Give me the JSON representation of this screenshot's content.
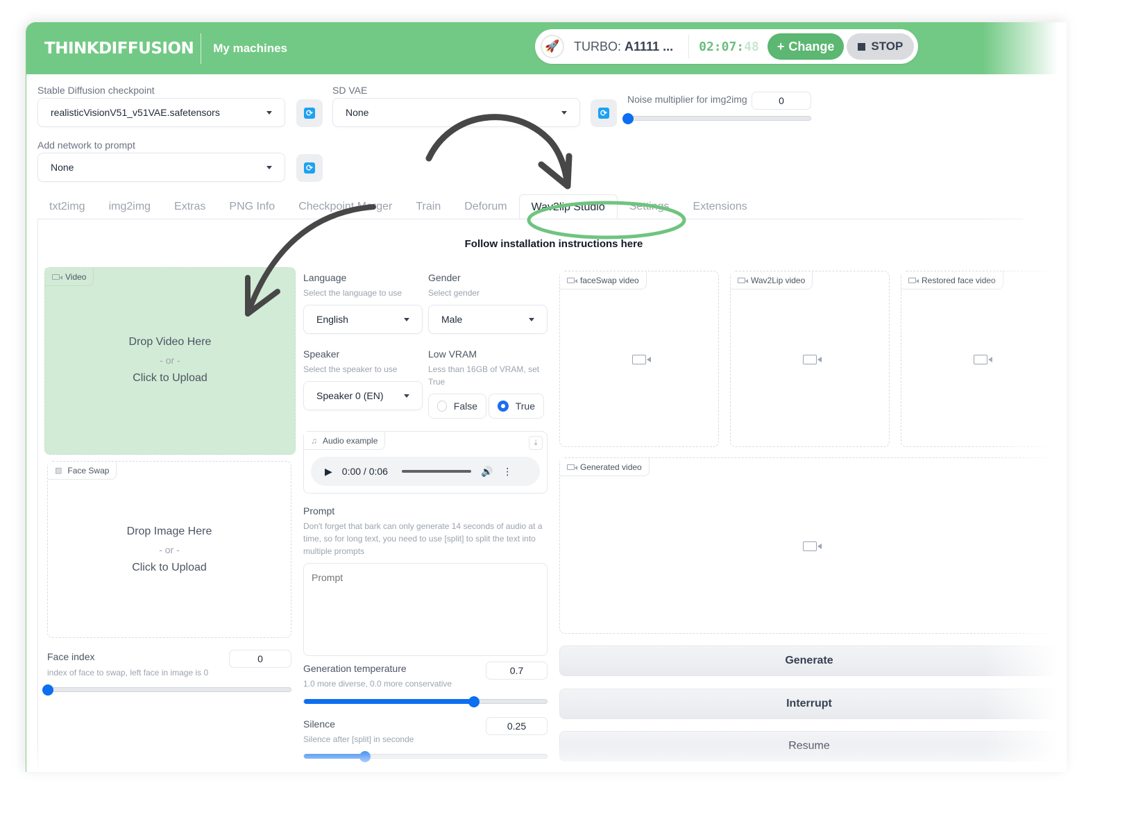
{
  "header": {
    "logo": "THINKDIFFUSION",
    "nav_link": "My machines",
    "machine": {
      "icon": "rocket-icon",
      "label_prefix": "TURBO:",
      "label_name": "A1111 ...",
      "timer_main": "02:07:",
      "timer_secs": "48",
      "change_label": "Change",
      "stop_label": "STOP"
    },
    "colors": {
      "brand": "#72c985",
      "accent_button": "#5bb771"
    }
  },
  "settings": {
    "checkpoint": {
      "label": "Stable Diffusion checkpoint",
      "value": "realisticVisionV51_v51VAE.safetensors"
    },
    "vae": {
      "label": "SD VAE",
      "value": "None"
    },
    "noise": {
      "label": "Noise multiplier for img2img",
      "value": "0",
      "fraction": 0
    },
    "network": {
      "label": "Add network to prompt",
      "value": "None"
    }
  },
  "tabs": [
    {
      "label": "txt2img"
    },
    {
      "label": "img2img"
    },
    {
      "label": "Extras"
    },
    {
      "label": "PNG Info"
    },
    {
      "label": "Checkpoint Merger"
    },
    {
      "label": "Train"
    },
    {
      "label": "Deforum"
    },
    {
      "label": "Wav2lip Studio",
      "active": true
    },
    {
      "label": "Settings"
    },
    {
      "label": "Extensions"
    }
  ],
  "main": {
    "install_link": "Follow installation instructions here",
    "video_upload": {
      "tag": "Video",
      "line1": "Drop Video Here",
      "line2": "- or -",
      "line3": "Click to Upload"
    },
    "face_swap_upload": {
      "tag": "Face Swap",
      "line1": "Drop Image Here",
      "line2": "- or -",
      "line3": "Click to Upload"
    },
    "face_index": {
      "label": "Face index",
      "info": "index of face to swap, left face in image is 0",
      "value": "0",
      "fraction": 0
    },
    "language": {
      "label": "Language",
      "info": "Select the language to use",
      "value": "English"
    },
    "gender": {
      "label": "Gender",
      "info": "Select gender",
      "value": "Male"
    },
    "speaker": {
      "label": "Speaker",
      "info": "Select the speaker to use",
      "value": "Speaker 0 (EN)"
    },
    "low_vram": {
      "label": "Low VRAM",
      "info": "Less than 16GB of VRAM, set True",
      "options": [
        "False",
        "True"
      ],
      "selected": "True"
    },
    "audio": {
      "tag": "Audio example",
      "time": "0:00 / 0:06"
    },
    "prompt": {
      "label": "Prompt",
      "info": "Don't forget that bark can only generate 14 seconds of audio at a time, so for long text, you need to use [split] to split the text into multiple prompts",
      "placeholder": "Prompt"
    },
    "temperature": {
      "label": "Generation temperature",
      "info": "1.0 more diverse, 0.0 more conservative",
      "value": "0.7",
      "fraction": 0.7
    },
    "silence": {
      "label": "Silence",
      "info": "Silence after [split] in seconde",
      "value": "0.25",
      "fraction": 0.25
    },
    "outputs": {
      "faceswap": "faceSwap video",
      "wav2lip": "Wav2Lip video",
      "restored": "Restored face video",
      "generated": "Generated video"
    },
    "buttons": {
      "generate": "Generate",
      "interrupt": "Interrupt",
      "resume": "Resume"
    }
  }
}
